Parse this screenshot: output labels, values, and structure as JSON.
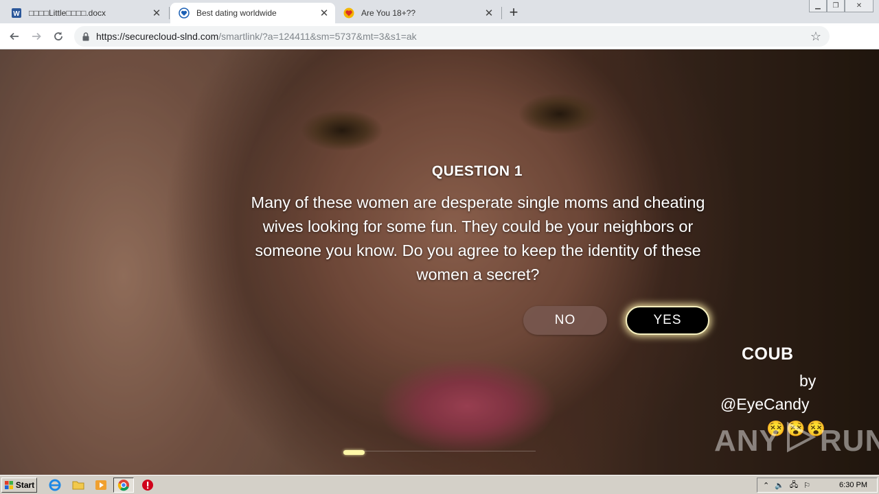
{
  "browser": {
    "tabs": [
      {
        "title": "□□□□Little□□□□.docx",
        "icon": "word-doc-icon",
        "active": false
      },
      {
        "title": "Best dating worldwide",
        "icon": "shield-heart-icon",
        "active": true
      },
      {
        "title": "Are You 18+??",
        "icon": "heart-icon",
        "active": false
      }
    ],
    "url_host": "https://securecloud-slnd.com",
    "url_path": "/smartlink/?a=124411&sm=5737&mt=3&s1=ak"
  },
  "page": {
    "question_title": "QUESTION 1",
    "question_text": "Many of these women are desperate single moms and cheating wives looking for some fun. They could be your neighbors or someone you know. Do you agree to keep the identity of these women a secret?",
    "no_label": "NO",
    "yes_label": "YES",
    "credit_brand": "COUB",
    "credit_by": "by",
    "credit_author": "@EyeCandy",
    "credit_emojis": "😵😵😵",
    "progress": 0.11,
    "watermark_left": "ANY",
    "watermark_right": "RUN"
  },
  "taskbar": {
    "start_label": "Start",
    "clock": "6:30 PM"
  },
  "colors": {
    "yes_glow": "#fff7a8",
    "no_bg": "#785850",
    "yes_bg": "#000000"
  }
}
